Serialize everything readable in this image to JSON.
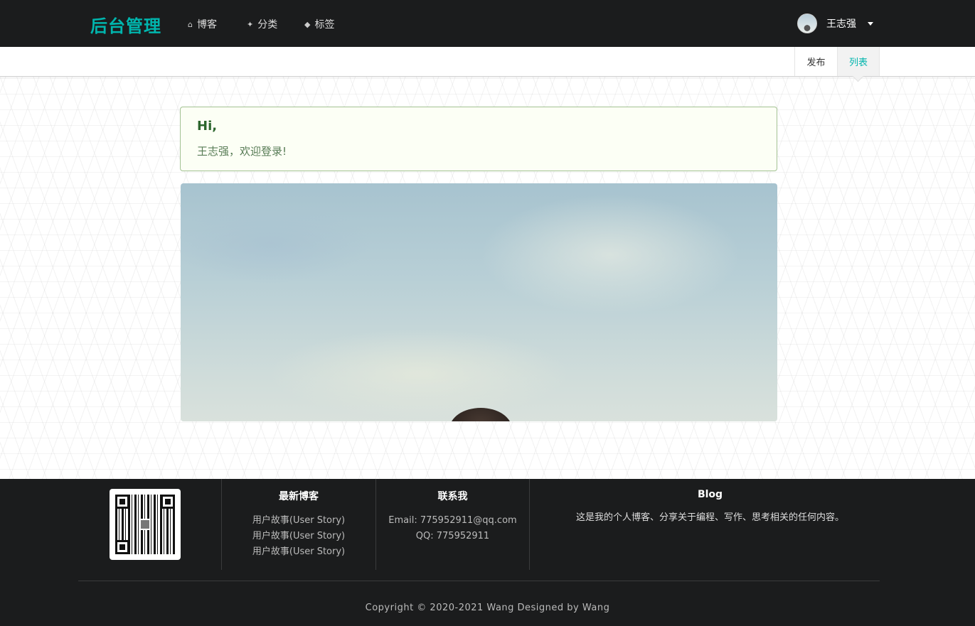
{
  "nav": {
    "brand": "后台管理",
    "items": [
      {
        "icon": "home-icon",
        "glyph": "⌂",
        "label": "博客"
      },
      {
        "icon": "lightbulb-icon",
        "glyph": "💡",
        "label": "分类"
      },
      {
        "icon": "tags-icon",
        "glyph": "🏷",
        "label": "标签"
      }
    ],
    "user": {
      "name": "王志强"
    }
  },
  "submenu": {
    "items": [
      {
        "label": "发布",
        "active": false
      },
      {
        "label": "列表",
        "active": true
      }
    ]
  },
  "message": {
    "header": "Hi,",
    "text": "王志强，欢迎登录!"
  },
  "footer": {
    "latest": {
      "title": "最新博客",
      "items": [
        "用户故事(User Story)",
        "用户故事(User Story)",
        "用户故事(User Story)"
      ]
    },
    "contact": {
      "title": "联系我",
      "email": "Email: 775952911@qq.com",
      "qq": "QQ: 775952911"
    },
    "blog": {
      "title": "Blog",
      "text": "这是我的个人博客、分享关于编程、写作、思考相关的任何内容。"
    },
    "copyright": "Copyright © 2020-2021 Wang Designed by Wang"
  },
  "colors": {
    "accent": "#00b5ad",
    "nav_bg": "#1b1c1d",
    "message_bg": "#fcfff5",
    "message_border": "#a3c293"
  }
}
